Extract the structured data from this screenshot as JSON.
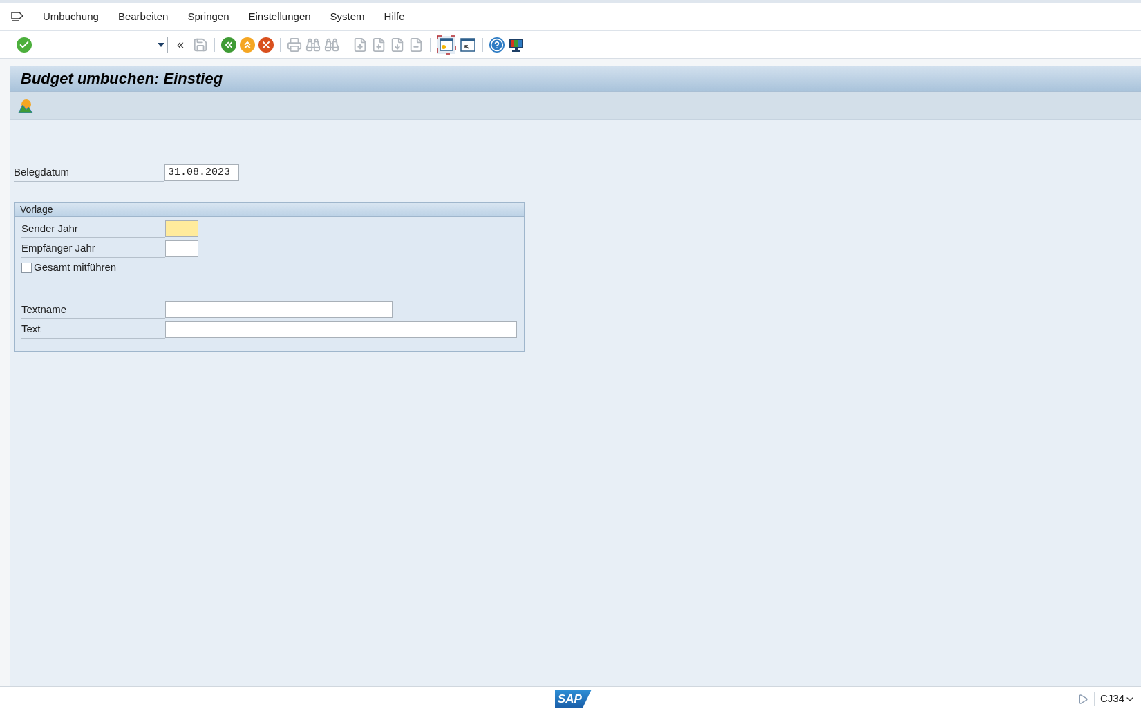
{
  "menu": [
    {
      "label": "Umbuchung"
    },
    {
      "label": "Bearbeiten"
    },
    {
      "label": "Springen"
    },
    {
      "label": "Einstellungen"
    },
    {
      "label": "System"
    },
    {
      "label": "Hilfe"
    }
  ],
  "toolbar": {
    "back_chevrons": "«",
    "buttons": [
      {
        "disabled": false
      },
      {
        "disabled": true
      },
      {
        "disabled": false
      },
      {
        "disabled": false
      },
      {
        "disabled": false
      },
      {
        "disabled": true
      },
      {
        "disabled": true
      },
      {
        "disabled": true
      },
      {
        "disabled": true
      },
      {
        "disabled": true
      },
      {
        "disabled": true
      },
      {
        "disabled": true
      },
      {
        "disabled": false
      },
      {
        "disabled": false
      },
      {
        "disabled": false
      },
      {
        "disabled": false
      }
    ]
  },
  "title": "Budget umbuchen: Einstieg",
  "fields": [
    {
      "label": "Belegdatum",
      "value": "31.08.2023"
    }
  ],
  "group": {
    "title": "Vorlage",
    "rows": [
      {
        "kind": "field",
        "label": "Sender Jahr",
        "required": true
      },
      {
        "kind": "field",
        "label": "Empfänger Jahr",
        "required": false
      },
      {
        "kind": "checkbox",
        "label": "Gesamt mitführen",
        "checked": false
      },
      {
        "kind": "gap"
      },
      {
        "kind": "field",
        "label": "Textname",
        "required": false
      },
      {
        "kind": "field",
        "label": "Text",
        "required": false
      }
    ]
  },
  "status_bar": {
    "logo": "SAP",
    "transaction": "CJ34"
  }
}
